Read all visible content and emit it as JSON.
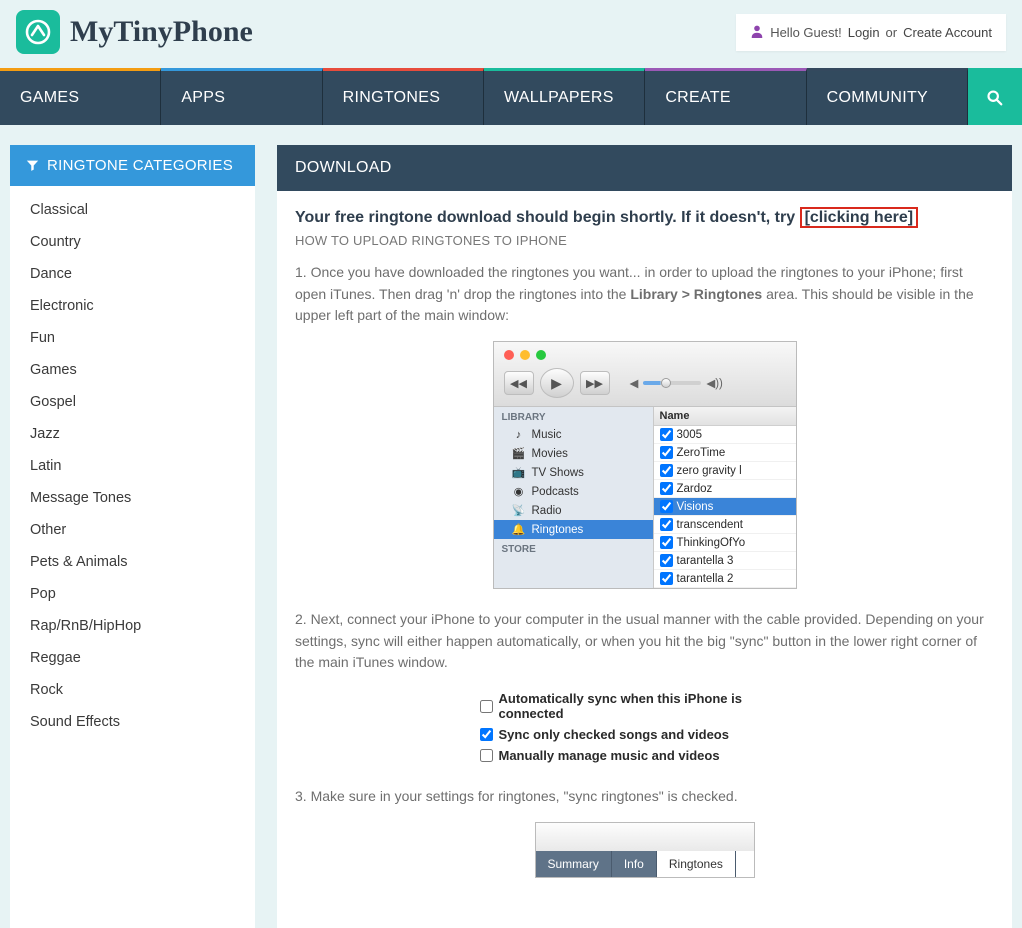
{
  "header": {
    "brand": "MyTinyPhone",
    "greet_prefix": "Hello Guest! ",
    "login": "Login",
    "or": " or ",
    "create": "Create Account"
  },
  "nav": {
    "items": [
      "GAMES",
      "APPS",
      "RINGTONES",
      "WALLPAPERS",
      "CREATE",
      "COMMUNITY"
    ]
  },
  "sidebar": {
    "title": "RINGTONE CATEGORIES",
    "items": [
      "Classical",
      "Country",
      "Dance",
      "Electronic",
      "Fun",
      "Games",
      "Gospel",
      "Jazz",
      "Latin",
      "Message Tones",
      "Other",
      "Pets & Animals",
      "Pop",
      "Rap/RnB/HipHop",
      "Reggae",
      "Rock",
      "Sound Effects"
    ]
  },
  "content": {
    "title": "DOWNLOAD",
    "notice_prefix": "Your free ringtone download should begin shortly. If it doesn't, try ",
    "notice_link": "[clicking here]",
    "sub": "HOW TO UPLOAD RINGTONES TO IPHONE",
    "step1_a": "1. Once you have downloaded the ringtones you want... in order to upload the ringtones to your iPhone; first open iTunes. Then drag 'n' drop the ringtones into the ",
    "step1_b": "Library > Ringtones",
    "step1_c": " area. This should be visible in the upper left part of the main window:",
    "step2": "2. Next, connect your iPhone to your computer in the usual manner with the cable provided. Depending on your settings, sync will either happen automatically, or when you hit the big \"sync\" button in the lower right corner of the main iTunes window.",
    "step3": "3. Make sure in your settings for ringtones, \"sync ringtones\" is checked.",
    "itunes": {
      "lib_head": "LIBRARY",
      "store_head": "STORE",
      "side": [
        {
          "icon": "♪",
          "label": "Music"
        },
        {
          "icon": "🎬",
          "label": "Movies"
        },
        {
          "icon": "📺",
          "label": "TV Shows"
        },
        {
          "icon": "◉",
          "label": "Podcasts"
        },
        {
          "icon": "📡",
          "label": "Radio"
        },
        {
          "icon": "🔔",
          "label": "Ringtones",
          "selected": true
        }
      ],
      "col": "Name",
      "tracks": [
        {
          "name": "3005",
          "checked": true
        },
        {
          "name": "ZeroTime",
          "checked": true
        },
        {
          "name": "zero gravity l",
          "checked": true
        },
        {
          "name": "Zardoz",
          "checked": true
        },
        {
          "name": "Visions",
          "checked": true,
          "selected": true
        },
        {
          "name": "transcendent",
          "checked": true
        },
        {
          "name": "ThinkingOfYo",
          "checked": true
        },
        {
          "name": "tarantella 3",
          "checked": true
        },
        {
          "name": "tarantella 2",
          "checked": true
        }
      ]
    },
    "sync": {
      "opt1": "Automatically sync when this iPhone is connected",
      "opt2": "Sync only checked songs and videos",
      "opt3": "Manually manage music and videos"
    },
    "iphone_tabs": [
      "Summary",
      "Info",
      "Ringtones"
    ]
  }
}
